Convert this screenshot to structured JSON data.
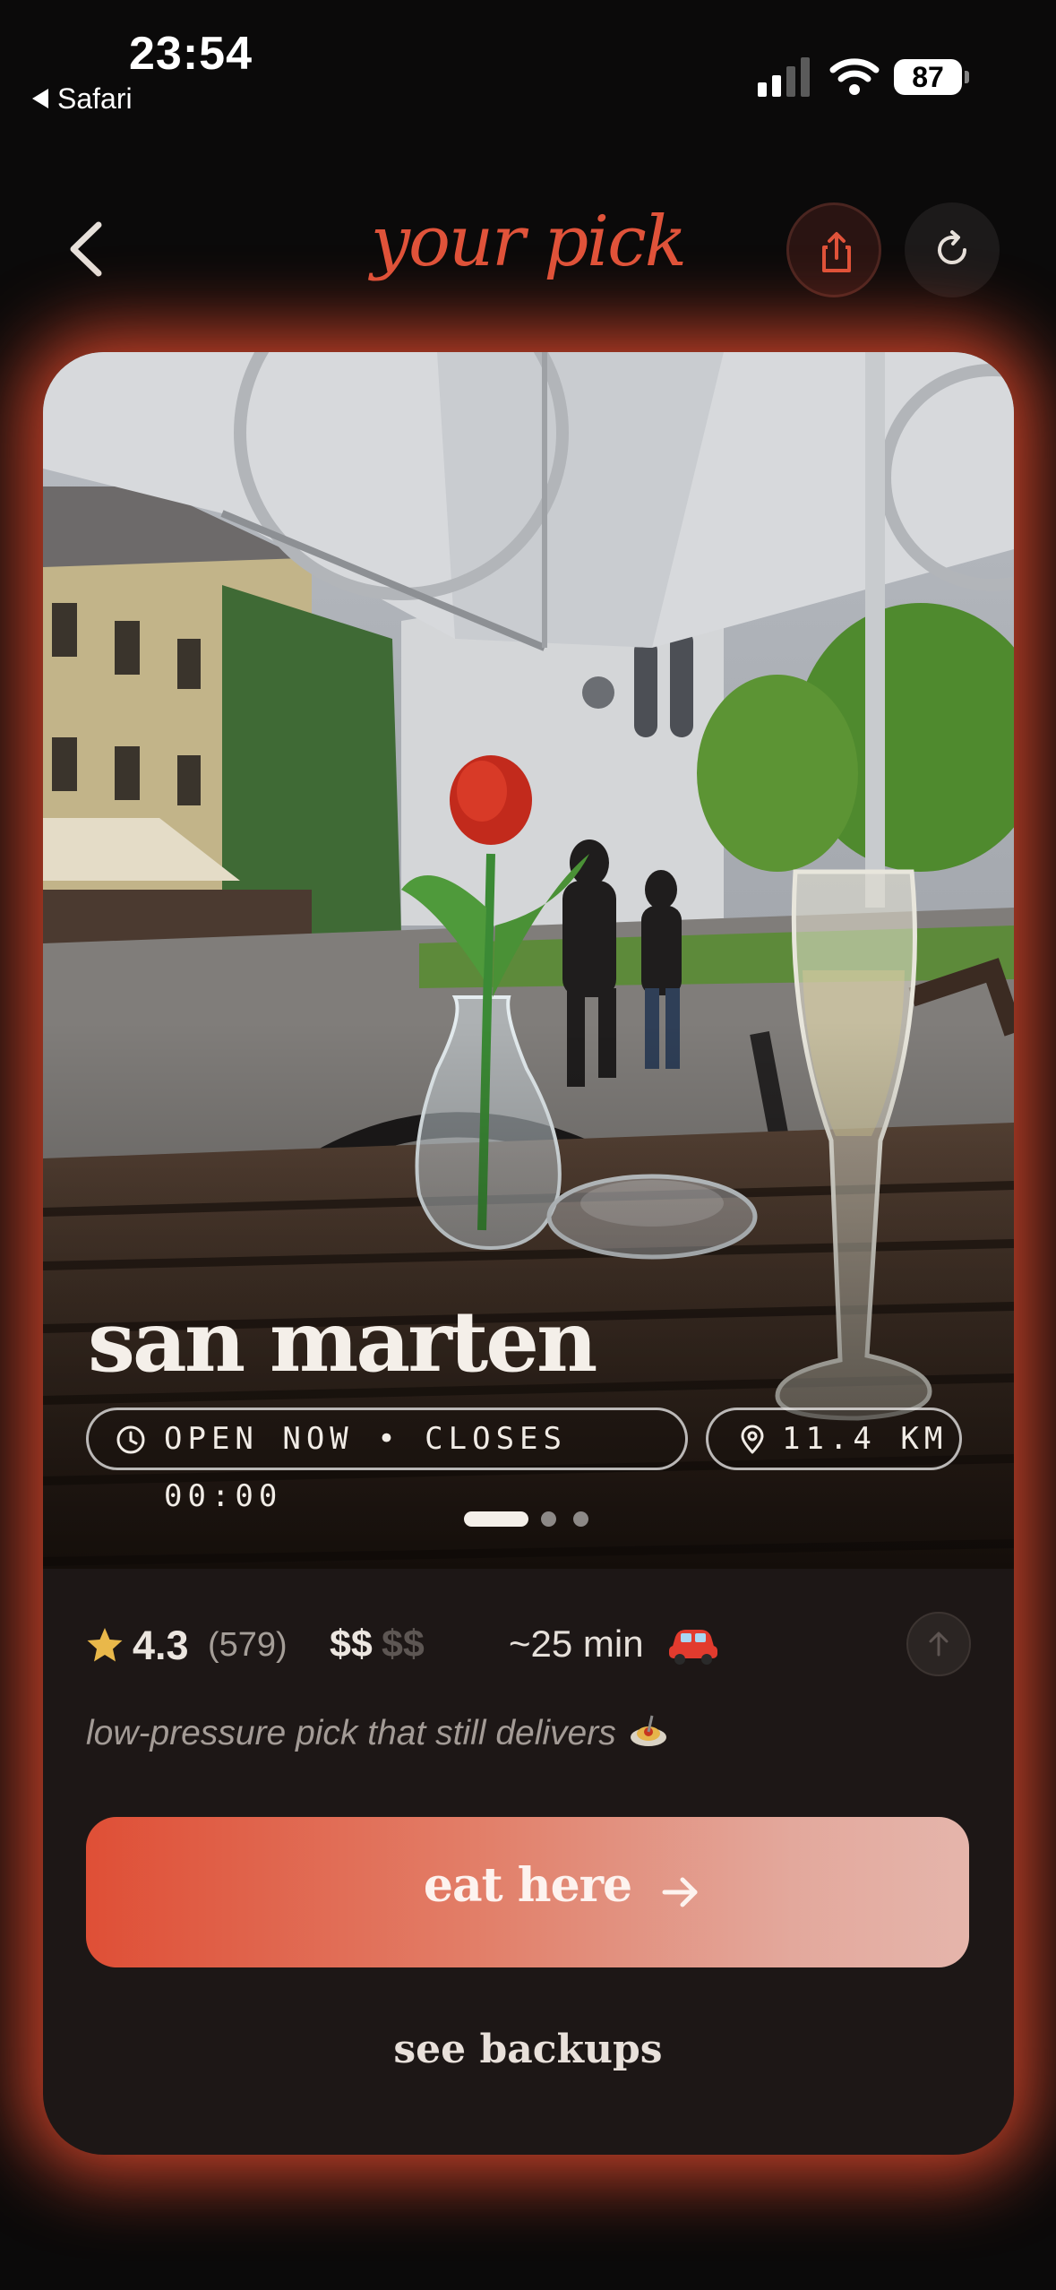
{
  "status_bar": {
    "time": "23:54",
    "back_app": "Safari",
    "battery": "87"
  },
  "header": {
    "title": "your pick",
    "back_icon": "chevron-left-icon",
    "share_icon": "share-icon",
    "refresh_icon": "refresh-icon"
  },
  "colors": {
    "accent": "#e0533a",
    "card_bg": "#1d1716",
    "glow": "#de4628"
  },
  "place": {
    "name": "san marten",
    "hours": "OPEN NOW • CLOSES 00:00",
    "distance": "11.4 KM",
    "photo_index": 1,
    "photo_count": 3,
    "rating": "4.3",
    "reviews": "(579)",
    "price_active": "$$",
    "price_inactive": "$$",
    "travel_time": "~25 min",
    "travel_icon": "car-icon",
    "tagline": "low-pressure pick that still delivers",
    "tagline_icon": "spaghetti-icon"
  },
  "actions": {
    "primary": "eat here",
    "secondary": "see backups"
  }
}
